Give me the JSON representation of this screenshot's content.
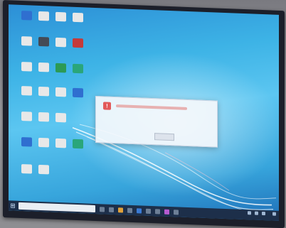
{
  "desktop": {
    "icons": [
      {
        "name": "icon-1",
        "color": "#2f6fd0",
        "label": ""
      },
      {
        "name": "icon-2",
        "color": "#e8e8e8",
        "label": ""
      },
      {
        "name": "icon-3",
        "color": "#e8e8e8",
        "label": ""
      },
      {
        "name": "icon-4",
        "color": "#e8e8e8",
        "label": ""
      },
      {
        "name": "icon-5",
        "color": "#e8e8e8",
        "label": ""
      },
      {
        "name": "icon-6",
        "color": "#444a55",
        "label": ""
      },
      {
        "name": "icon-7",
        "color": "#e8e8e8",
        "label": ""
      },
      {
        "name": "icon-8",
        "color": "#c43a3a",
        "label": ""
      },
      {
        "name": "icon-9",
        "color": "#e8e8e8",
        "label": ""
      },
      {
        "name": "icon-10",
        "color": "#e8e8e8",
        "label": ""
      },
      {
        "name": "icon-11",
        "color": "#2c9a55",
        "label": ""
      },
      {
        "name": "icon-12",
        "color": "#2aa67a",
        "label": ""
      },
      {
        "name": "icon-13",
        "color": "#e8e8e8",
        "label": ""
      },
      {
        "name": "icon-14",
        "color": "#e8e8e8",
        "label": ""
      },
      {
        "name": "icon-15",
        "color": "#e8e8e8",
        "label": ""
      },
      {
        "name": "icon-16",
        "color": "#2f6fd0",
        "label": ""
      },
      {
        "name": "icon-17",
        "color": "#e8e8e8",
        "label": ""
      },
      {
        "name": "icon-18",
        "color": "#e8e8e8",
        "label": ""
      },
      {
        "name": "icon-19",
        "color": "#e8e8e8",
        "label": ""
      },
      {
        "name": "icon-20",
        "color": "#2f6fd0",
        "label": ""
      },
      {
        "name": "icon-21",
        "color": "#e8e8e8",
        "label": ""
      },
      {
        "name": "icon-22",
        "color": "#e8e8e8",
        "label": ""
      },
      {
        "name": "icon-23",
        "color": "#2aa67a",
        "label": ""
      },
      {
        "name": "icon-24",
        "color": "#e8e8e8",
        "label": ""
      },
      {
        "name": "icon-25",
        "color": "#e8e8e8",
        "label": ""
      }
    ]
  },
  "dialog": {
    "icon": "error-icon",
    "accent": "#e25a5a",
    "message": "",
    "button_label": ""
  },
  "taskbar": {
    "start_glyph": "⊞",
    "search_placeholder": "",
    "clock_time": "",
    "clock_date": "",
    "app_colors": [
      "#6d7f96",
      "#6d7f96",
      "#e0a13a",
      "#6d7f96",
      "#3a7bd5",
      "#6d7f96",
      "#6d7f96",
      "#b65bd0",
      "#6d7f96"
    ]
  }
}
